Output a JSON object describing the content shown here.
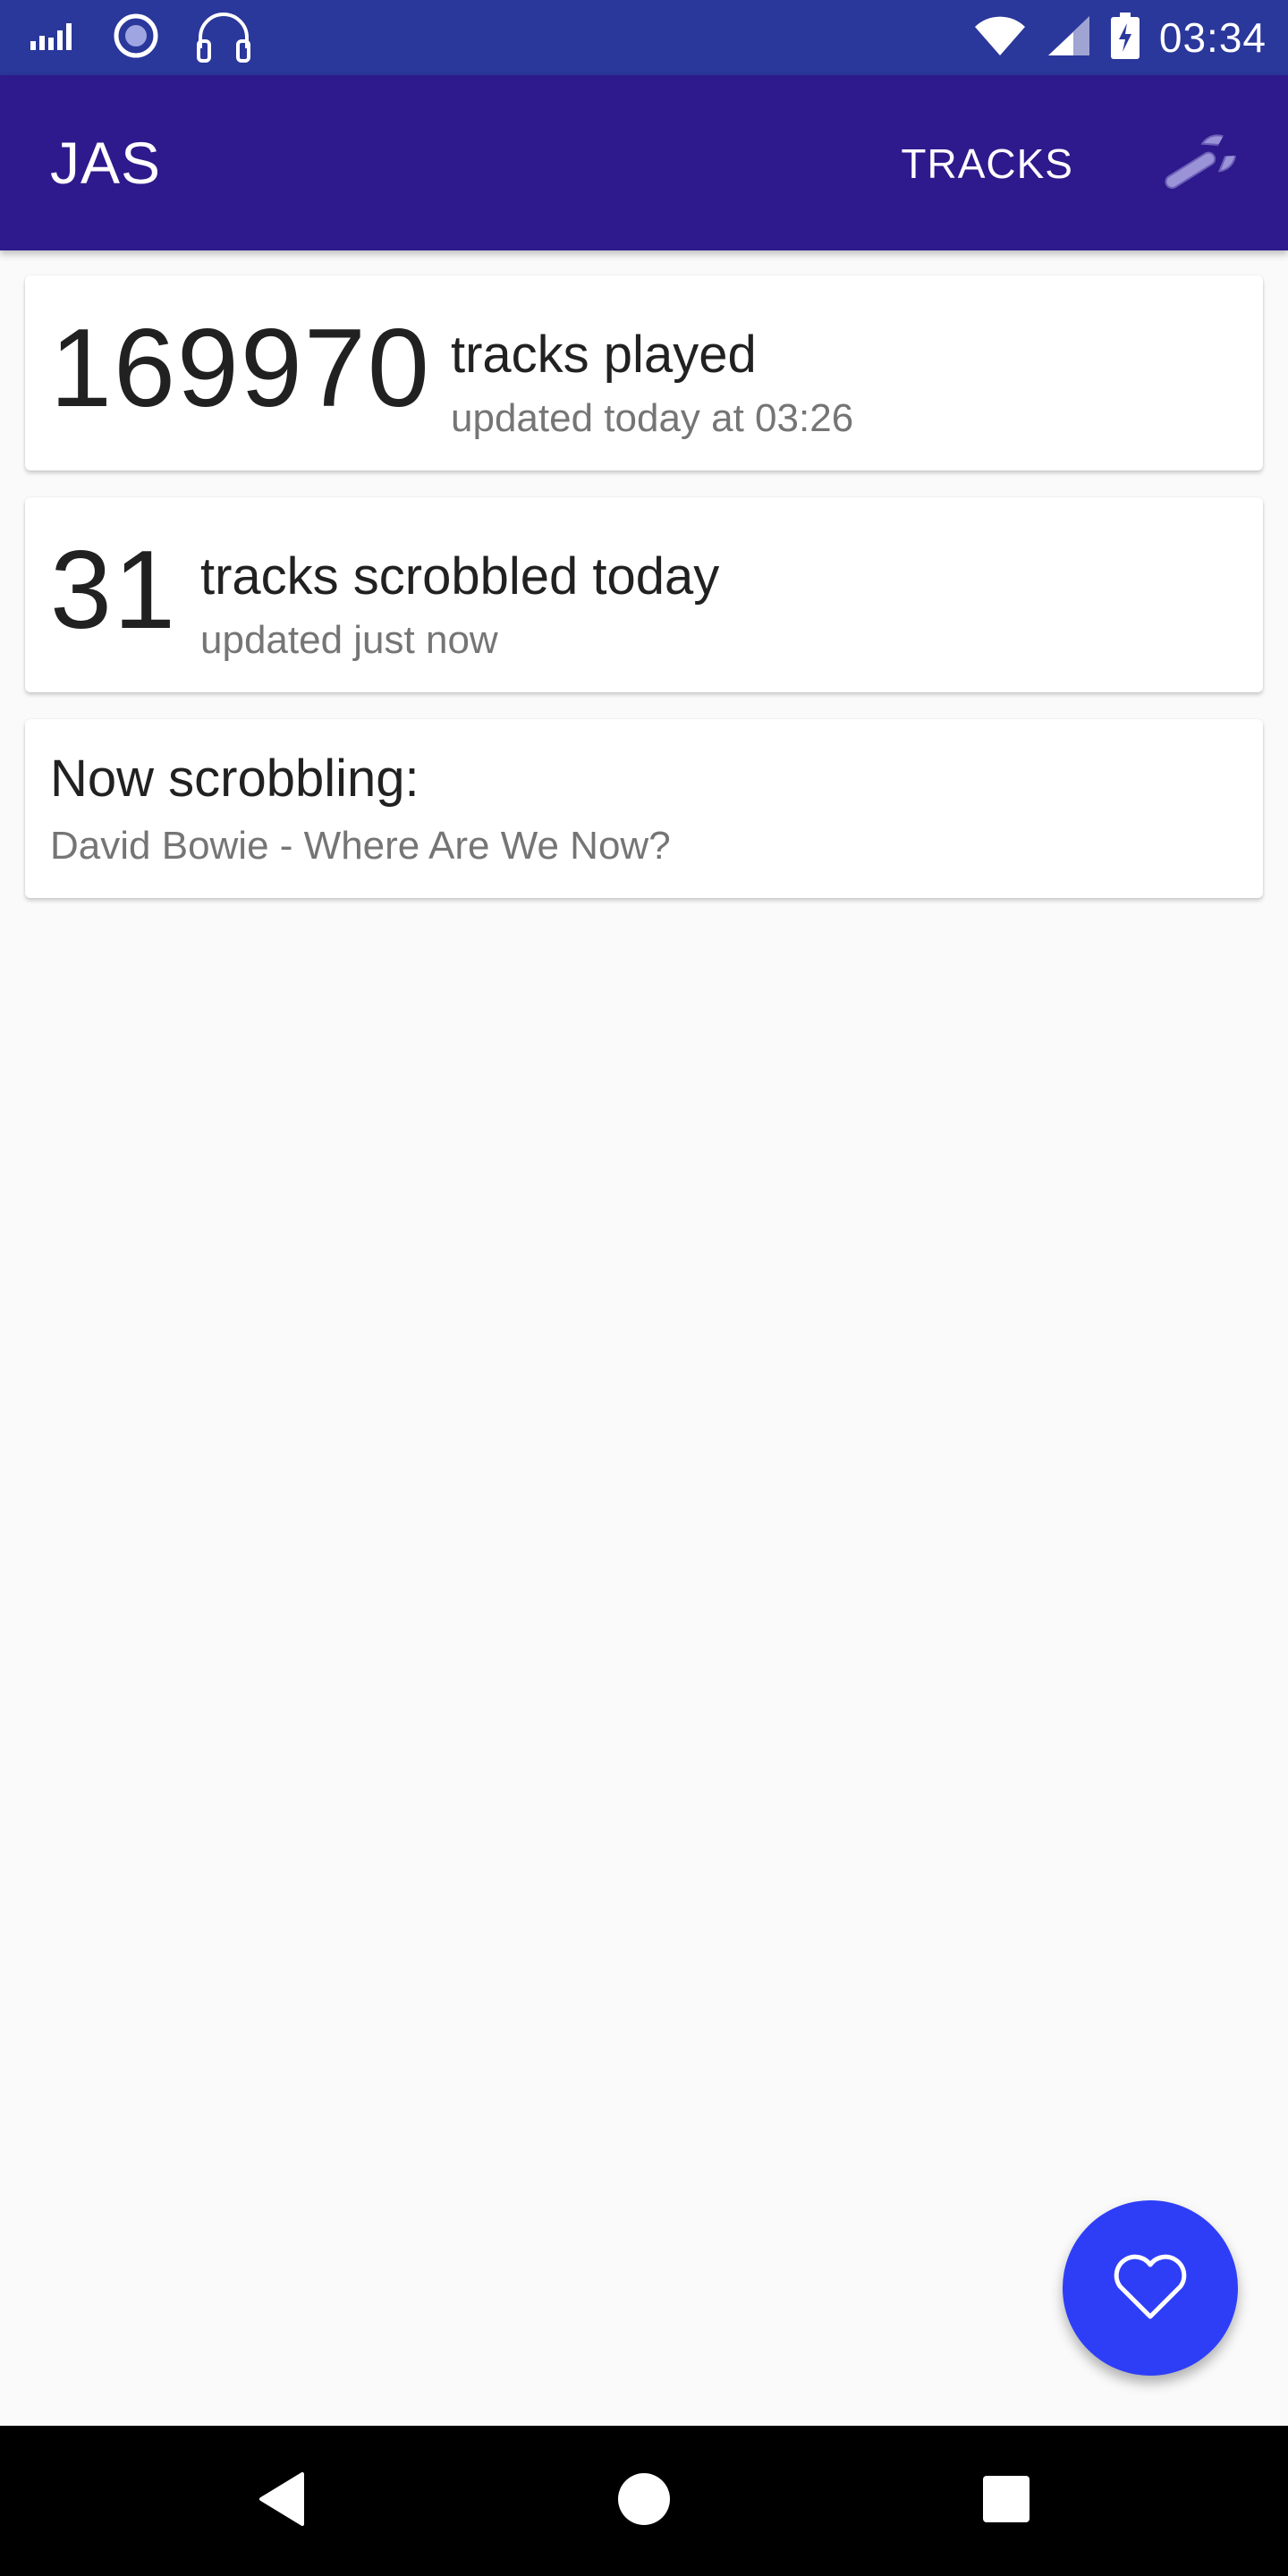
{
  "status_bar": {
    "time": "03:34",
    "icons": [
      "signal-bars-icon",
      "record-icon",
      "headphones-icon",
      "wifi-icon",
      "cell-signal-icon",
      "battery-charging-icon"
    ]
  },
  "app_bar": {
    "title": "JAS",
    "tracks_label": "TRACKS",
    "settings_icon": "wrench-icon"
  },
  "cards": {
    "played": {
      "count": "169970",
      "title": "tracks played",
      "subtitle": "updated today at 03:26"
    },
    "scrobbled": {
      "count": "31",
      "title": "tracks scrobbled today",
      "subtitle": "updated just now"
    },
    "now": {
      "title": "Now scrobbling:",
      "track": "David Bowie - Where Are We Now?"
    }
  },
  "fab": {
    "icon": "heart-icon",
    "color": "#2e3ef7"
  },
  "nav_bar": {
    "icons": [
      "back-icon",
      "home-icon",
      "recents-icon"
    ]
  },
  "colors": {
    "status_bar": "#2a379b",
    "app_bar": "#2e1a8c",
    "background": "#fafafa"
  }
}
